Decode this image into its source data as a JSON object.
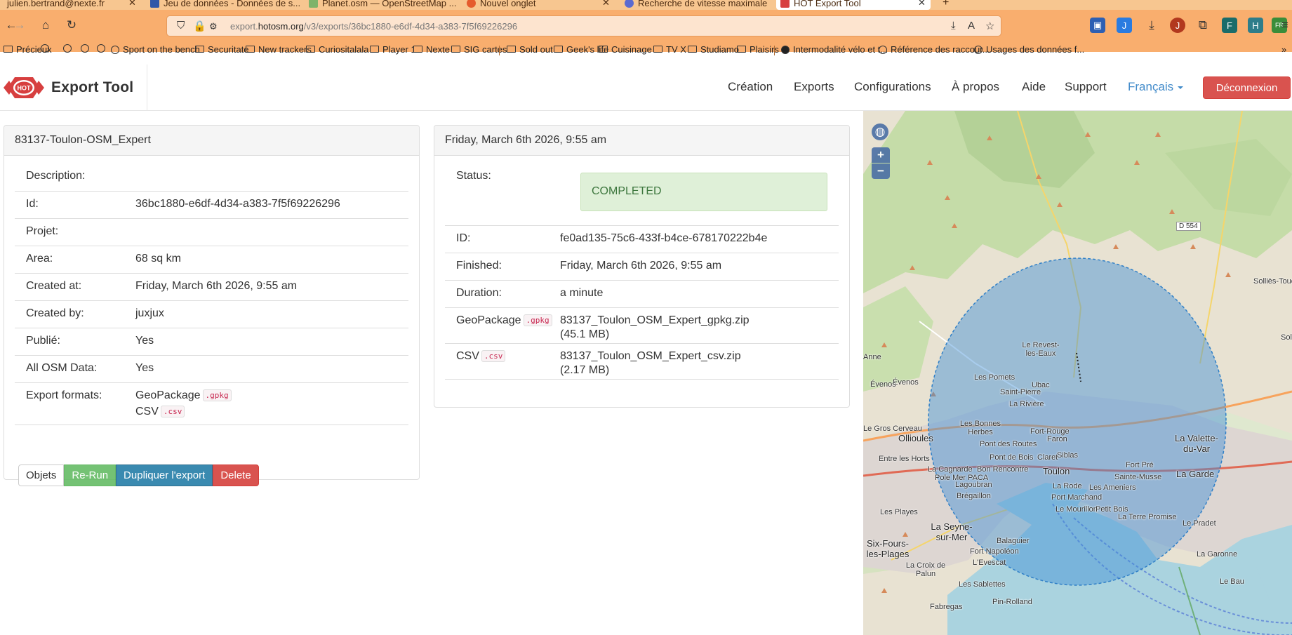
{
  "browser": {
    "tabs": [
      {
        "title": "julien.bertrand@nexte.fr",
        "active": false
      },
      {
        "title": "Jeu de données - Données de s...",
        "active": false
      },
      {
        "title": "Planet.osm — OpenStreetMap ...",
        "active": false
      },
      {
        "title": "Nouvel onglet",
        "active": false
      },
      {
        "title": "Recherche de vitesse maximale",
        "active": false
      },
      {
        "title": "HOT Export Tool",
        "active": true
      }
    ],
    "url": {
      "prefix": "export.",
      "domain": "hotosm.org",
      "path": "/v3/exports/36bc1880-e6df-4d34-a383-7f5f69226296"
    },
    "bookmarks": [
      {
        "label": "Précieux",
        "kind": "folder"
      },
      {
        "label": "",
        "kind": "globe"
      },
      {
        "label": "",
        "kind": "globe"
      },
      {
        "label": "",
        "kind": "globe"
      },
      {
        "label": "",
        "kind": "globe"
      },
      {
        "label": "Sport on the bench",
        "kind": "globe"
      },
      {
        "label": "Securitate",
        "kind": "folder"
      },
      {
        "label": "New trackers",
        "kind": "folder"
      },
      {
        "label": "Curiositalala",
        "kind": "folder"
      },
      {
        "label": "Player 1",
        "kind": "folder"
      },
      {
        "label": "Nexte",
        "kind": "folder"
      },
      {
        "label": "SIG cartes",
        "kind": "folder"
      },
      {
        "label": "Sold out",
        "kind": "folder"
      },
      {
        "label": "Geek's life",
        "kind": "folder"
      },
      {
        "label": "Cuisinage",
        "kind": "folder"
      },
      {
        "label": "TV X",
        "kind": "folder"
      },
      {
        "label": "Studiamo",
        "kind": "folder"
      },
      {
        "label": "Plaisirs",
        "kind": "folder"
      },
      {
        "label": "Intermodalité vélo et t...",
        "kind": "site"
      },
      {
        "label": "Référence des raccour...",
        "kind": "globe"
      },
      {
        "label": "Usages des données f...",
        "kind": "globe"
      }
    ]
  },
  "app": {
    "brand": "Export Tool",
    "logo_text": "HOT",
    "nav": [
      "Création",
      "Exports",
      "Configurations",
      "À propos",
      "Aide",
      "Support"
    ],
    "language": "Français",
    "logout": "Déconnexion"
  },
  "export": {
    "title": "83137-Toulon-OSM_Expert",
    "rows": [
      {
        "label": "Description:",
        "value": ""
      },
      {
        "label": "Id:",
        "value": "36bc1880-e6df-4d34-a383-7f5f69226296"
      },
      {
        "label": "Projet:",
        "value": ""
      },
      {
        "label": "Area:",
        "value": "68 sq km"
      },
      {
        "label": "Created at:",
        "value": "Friday, March 6th 2026, 9:55 am"
      },
      {
        "label": "Created by:",
        "value": "juxjux"
      },
      {
        "label": "Publié:",
        "value": "Yes"
      },
      {
        "label": "All OSM Data:",
        "value": "Yes"
      },
      {
        "label": "Export formats:",
        "value": ""
      }
    ],
    "formats": [
      {
        "name": "GeoPackage",
        "ext": ".gpkg"
      },
      {
        "name": "CSV",
        "ext": ".csv"
      }
    ],
    "buttons": {
      "objects": "Objets",
      "rerun": "Re-Run",
      "duplicate": "Dupliquer l'export",
      "delete": "Delete"
    }
  },
  "run": {
    "title": "Friday, March 6th 2026, 9:55 am",
    "status_label": "Status:",
    "status": "COMPLETED",
    "rows": [
      {
        "label": "ID:",
        "value": "fe0ad135-75c6-433f-b4ce-678170222b4e"
      },
      {
        "label": "Finished:",
        "value": "Friday, March 6th 2026, 9:55 am"
      },
      {
        "label": "Duration:",
        "value": "a minute"
      }
    ],
    "files": [
      {
        "name": "GeoPackage",
        "ext": ".gpkg",
        "file": "83137_Toulon_OSM_Expert_gpkg.zip",
        "size": "(45.1 MB)"
      },
      {
        "name": "CSV",
        "ext": ".csv",
        "file": "83137_Toulon_OSM_Expert_csv.zip",
        "size": "(2.17 MB)"
      }
    ]
  },
  "map": {
    "zoom_in": "+",
    "zoom_out": "−",
    "labels": [
      "D 554",
      "Solliès-Toucas",
      "Solli",
      "Le Revest-les-Eaux",
      "Ollioules",
      "Évenos",
      "Les Pomets",
      "Ubac",
      "Saint-Pierre",
      "La Rivière",
      "Les Bonnes Herbes",
      "Fort-Rouge",
      "Faron",
      "Pont des Routes",
      "Pont de Bois",
      "Claret",
      "Siblas",
      "La Valette-du-Var",
      "Entre les Horts",
      "Le Gros Cerveau",
      "La Cagnarde",
      "Pole Mer PACA",
      "Bon Rencontre",
      "Toulon",
      "La Rode",
      "Les Ameniers",
      "Sainte-Musse",
      "Fort Pré",
      "La Garde",
      "Lagoubran",
      "Port Marchand",
      "Brégaillon",
      "Le Mourillon",
      "Petit Bois",
      "Les Playes",
      "La Seyne-sur-Mer",
      "La Terre Promise",
      "Le Pradet",
      "Six-Fours-les-Plages",
      "Fort Napoléon",
      "Balaguier",
      "L'Evescat",
      "La Croix de Palun",
      "La Garonne",
      "Les Sablettes",
      "Pin-Rolland",
      "Fabregas",
      "Le Bau",
      "Anne",
      "Évenos"
    ]
  }
}
